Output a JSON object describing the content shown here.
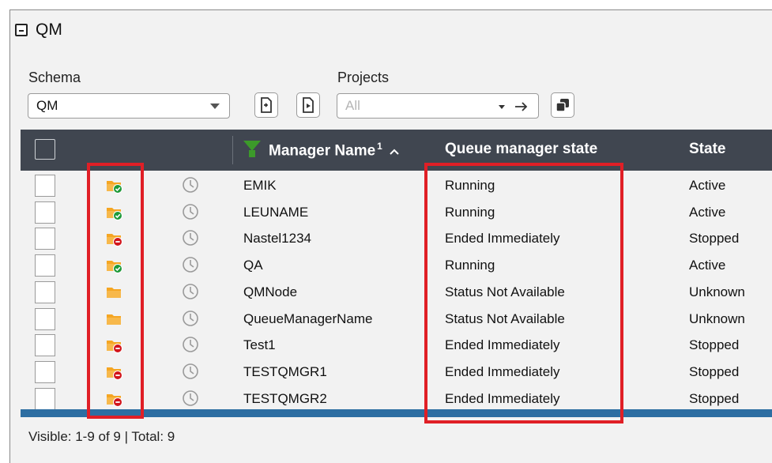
{
  "panel": {
    "title": "QM"
  },
  "filters": {
    "schema_label": "Schema",
    "schema_value": "QM",
    "projects_label": "Projects",
    "projects_placeholder": "All"
  },
  "table": {
    "headers": {
      "manager_name": "Manager Name",
      "sort_index": "1",
      "queue_manager_state": "Queue manager state",
      "state": "State"
    },
    "rows": [
      {
        "status_icon": "folder-running-icon",
        "name": "EMIK",
        "qm_state": "Running",
        "state": "Active"
      },
      {
        "status_icon": "folder-running-icon",
        "name": "LEUNAME",
        "qm_state": "Running",
        "state": "Active"
      },
      {
        "status_icon": "folder-stopped-icon",
        "name": "Nastel1234",
        "qm_state": "Ended Immediately",
        "state": "Stopped"
      },
      {
        "status_icon": "folder-running-icon",
        "name": "QA",
        "qm_state": "Running",
        "state": "Active"
      },
      {
        "status_icon": "folder-unknown-icon",
        "name": "QMNode",
        "qm_state": "Status Not Available",
        "state": "Unknown"
      },
      {
        "status_icon": "folder-unknown-icon",
        "name": "QueueManagerName",
        "qm_state": "Status Not Available",
        "state": "Unknown"
      },
      {
        "status_icon": "folder-stopped-icon",
        "name": "Test1",
        "qm_state": "Ended Immediately",
        "state": "Stopped"
      },
      {
        "status_icon": "folder-stopped-icon",
        "name": "TESTQMGR1",
        "qm_state": "Ended Immediately",
        "state": "Stopped"
      },
      {
        "status_icon": "folder-stopped-icon",
        "name": "TESTQMGR2",
        "qm_state": "Ended Immediately",
        "state": "Stopped"
      }
    ]
  },
  "footer": {
    "summary": "Visible: 1-9 of 9 | Total: 9"
  },
  "colors": {
    "header_bg": "#404650",
    "accent_blue": "#2d6ea2",
    "highlight_red": "#e01f26",
    "running_green": "#1f9a3a",
    "stopped_red": "#d2151c",
    "folder_orange": "#f5a623"
  }
}
